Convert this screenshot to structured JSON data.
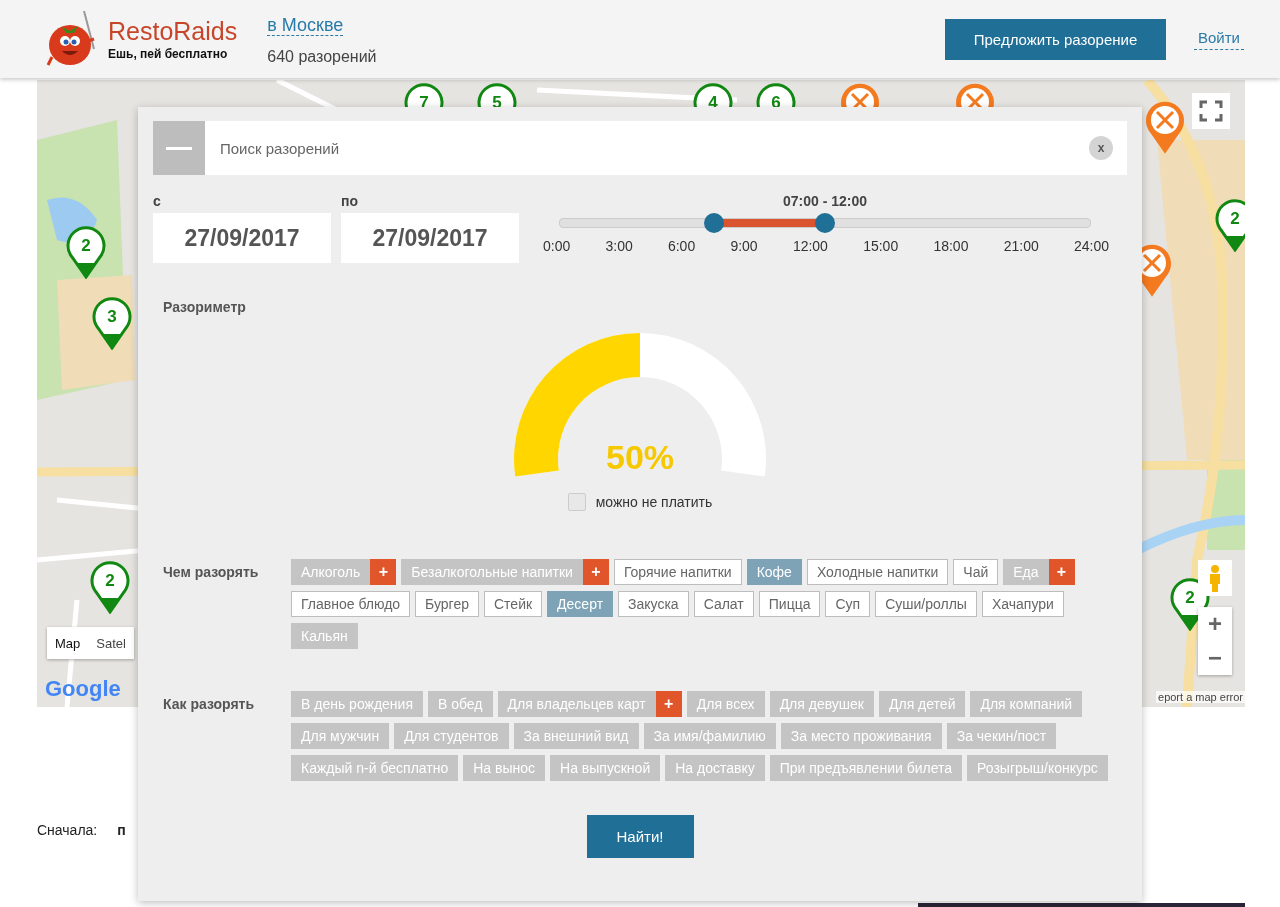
{
  "header": {
    "logo": {
      "name": "RestoRaids",
      "tagline": "Ешь, пей бесплатно"
    },
    "city": "в Москве",
    "count": "640 разорений",
    "propose_button": "Предложить разорение",
    "login_link": "Войти"
  },
  "map": {
    "pins": [
      {
        "kind": "cluster",
        "label": "7"
      },
      {
        "kind": "cluster",
        "label": "5"
      },
      {
        "kind": "cluster",
        "label": "4"
      },
      {
        "kind": "cluster",
        "label": "6"
      },
      {
        "kind": "restaurant"
      },
      {
        "kind": "restaurant"
      },
      {
        "kind": "restaurant"
      },
      {
        "kind": "cluster",
        "label": "2"
      },
      {
        "kind": "cluster",
        "label": "3"
      },
      {
        "kind": "cluster",
        "label": "2"
      },
      {
        "kind": "restaurant"
      },
      {
        "kind": "cluster",
        "label": "2"
      },
      {
        "kind": "cluster",
        "label": "2"
      }
    ],
    "type_tabs": [
      {
        "label": "Map",
        "selected": true
      },
      {
        "label": "Satel",
        "selected": false
      }
    ],
    "zoom_in": "+",
    "zoom_out": "−",
    "logo": "Google",
    "report_link": "eport a map error"
  },
  "filter_panel": {
    "search": {
      "placeholder": "Поиск разорений",
      "clear": "x"
    },
    "date_from": {
      "label": "с",
      "value": "27/09/2017"
    },
    "date_to": {
      "label": "по",
      "value": "27/09/2017"
    },
    "time_range": {
      "reading": "07:00 - 12:00",
      "start": {
        "level": 0.2917
      },
      "end": {
        "level": 0.5
      },
      "ticks": [
        "0:00",
        "3:00",
        "6:00",
        "9:00",
        "12:00",
        "15:00",
        "18:00",
        "21:00",
        "24:00"
      ]
    },
    "meter": {
      "title": "Разориметр",
      "level": 0.5,
      "reading": "50%",
      "free_checkbox": {
        "label": "можно не платить",
        "checked": false
      }
    },
    "what": {
      "title": "Чем разорять",
      "tags": [
        {
          "label": "Алкоголь",
          "kind": "category",
          "selected": false,
          "expand": "+"
        },
        {
          "label": "Безалкогольные напитки",
          "kind": "category",
          "selected": false,
          "expand": "+"
        },
        {
          "label": "Горячие напитки",
          "kind": "option",
          "selected": false
        },
        {
          "label": "Кофе",
          "kind": "option",
          "selected": true
        },
        {
          "label": "Холодные напитки",
          "kind": "option",
          "selected": false
        },
        {
          "label": "Чай",
          "kind": "option",
          "selected": false
        },
        {
          "label": "Еда",
          "kind": "category",
          "selected": false,
          "expand": "+"
        },
        {
          "label": "Главное блюдо",
          "kind": "option",
          "selected": false
        },
        {
          "label": "Бургер",
          "kind": "option",
          "selected": false
        },
        {
          "label": "Стейк",
          "kind": "option",
          "selected": false
        },
        {
          "label": "Десерт",
          "kind": "option",
          "selected": true
        },
        {
          "label": "Закуска",
          "kind": "option",
          "selected": false
        },
        {
          "label": "Салат",
          "kind": "option",
          "selected": false
        },
        {
          "label": "Пицца",
          "kind": "option",
          "selected": false
        },
        {
          "label": "Суп",
          "kind": "option",
          "selected": false
        },
        {
          "label": "Суши/роллы",
          "kind": "option",
          "selected": false
        },
        {
          "label": "Хачапури",
          "kind": "option",
          "selected": false
        },
        {
          "label": "Кальян",
          "kind": "category",
          "selected": false
        }
      ]
    },
    "how": {
      "title": "Как разорять",
      "tags": [
        {
          "label": "В день рождения",
          "kind": "category",
          "selected": false
        },
        {
          "label": "В обед",
          "kind": "category",
          "selected": false
        },
        {
          "label": "Для владельцев карт",
          "kind": "category",
          "selected": false,
          "expand": "+"
        },
        {
          "label": "Для всех",
          "kind": "category",
          "selected": false
        },
        {
          "label": "Для девушек",
          "kind": "category",
          "selected": false
        },
        {
          "label": "Для детей",
          "kind": "category",
          "selected": false
        },
        {
          "label": "Для компаний",
          "kind": "category",
          "selected": false
        },
        {
          "label": "Для мужчин",
          "kind": "category",
          "selected": false
        },
        {
          "label": "Для студентов",
          "kind": "category",
          "selected": false
        },
        {
          "label": "За внешний вид",
          "kind": "category",
          "selected": false
        },
        {
          "label": "За имя/фамилию",
          "kind": "category",
          "selected": false
        },
        {
          "label": "За место проживания",
          "kind": "category",
          "selected": false
        },
        {
          "label": "За чекин/пост",
          "kind": "category",
          "selected": false
        },
        {
          "label": "Каждый n-й бесплатно",
          "kind": "category",
          "selected": false
        },
        {
          "label": "На вынос",
          "kind": "category",
          "selected": false
        },
        {
          "label": "На выпускной",
          "kind": "category",
          "selected": false
        },
        {
          "label": "На доставку",
          "kind": "category",
          "selected": false
        },
        {
          "label": "При предъявлении билета",
          "kind": "category",
          "selected": false
        },
        {
          "label": "Розыгрыш/конкурс",
          "kind": "category",
          "selected": false
        }
      ]
    },
    "submit": "Найти!"
  },
  "sort": {
    "label": "Сначала:",
    "value": "п"
  }
}
